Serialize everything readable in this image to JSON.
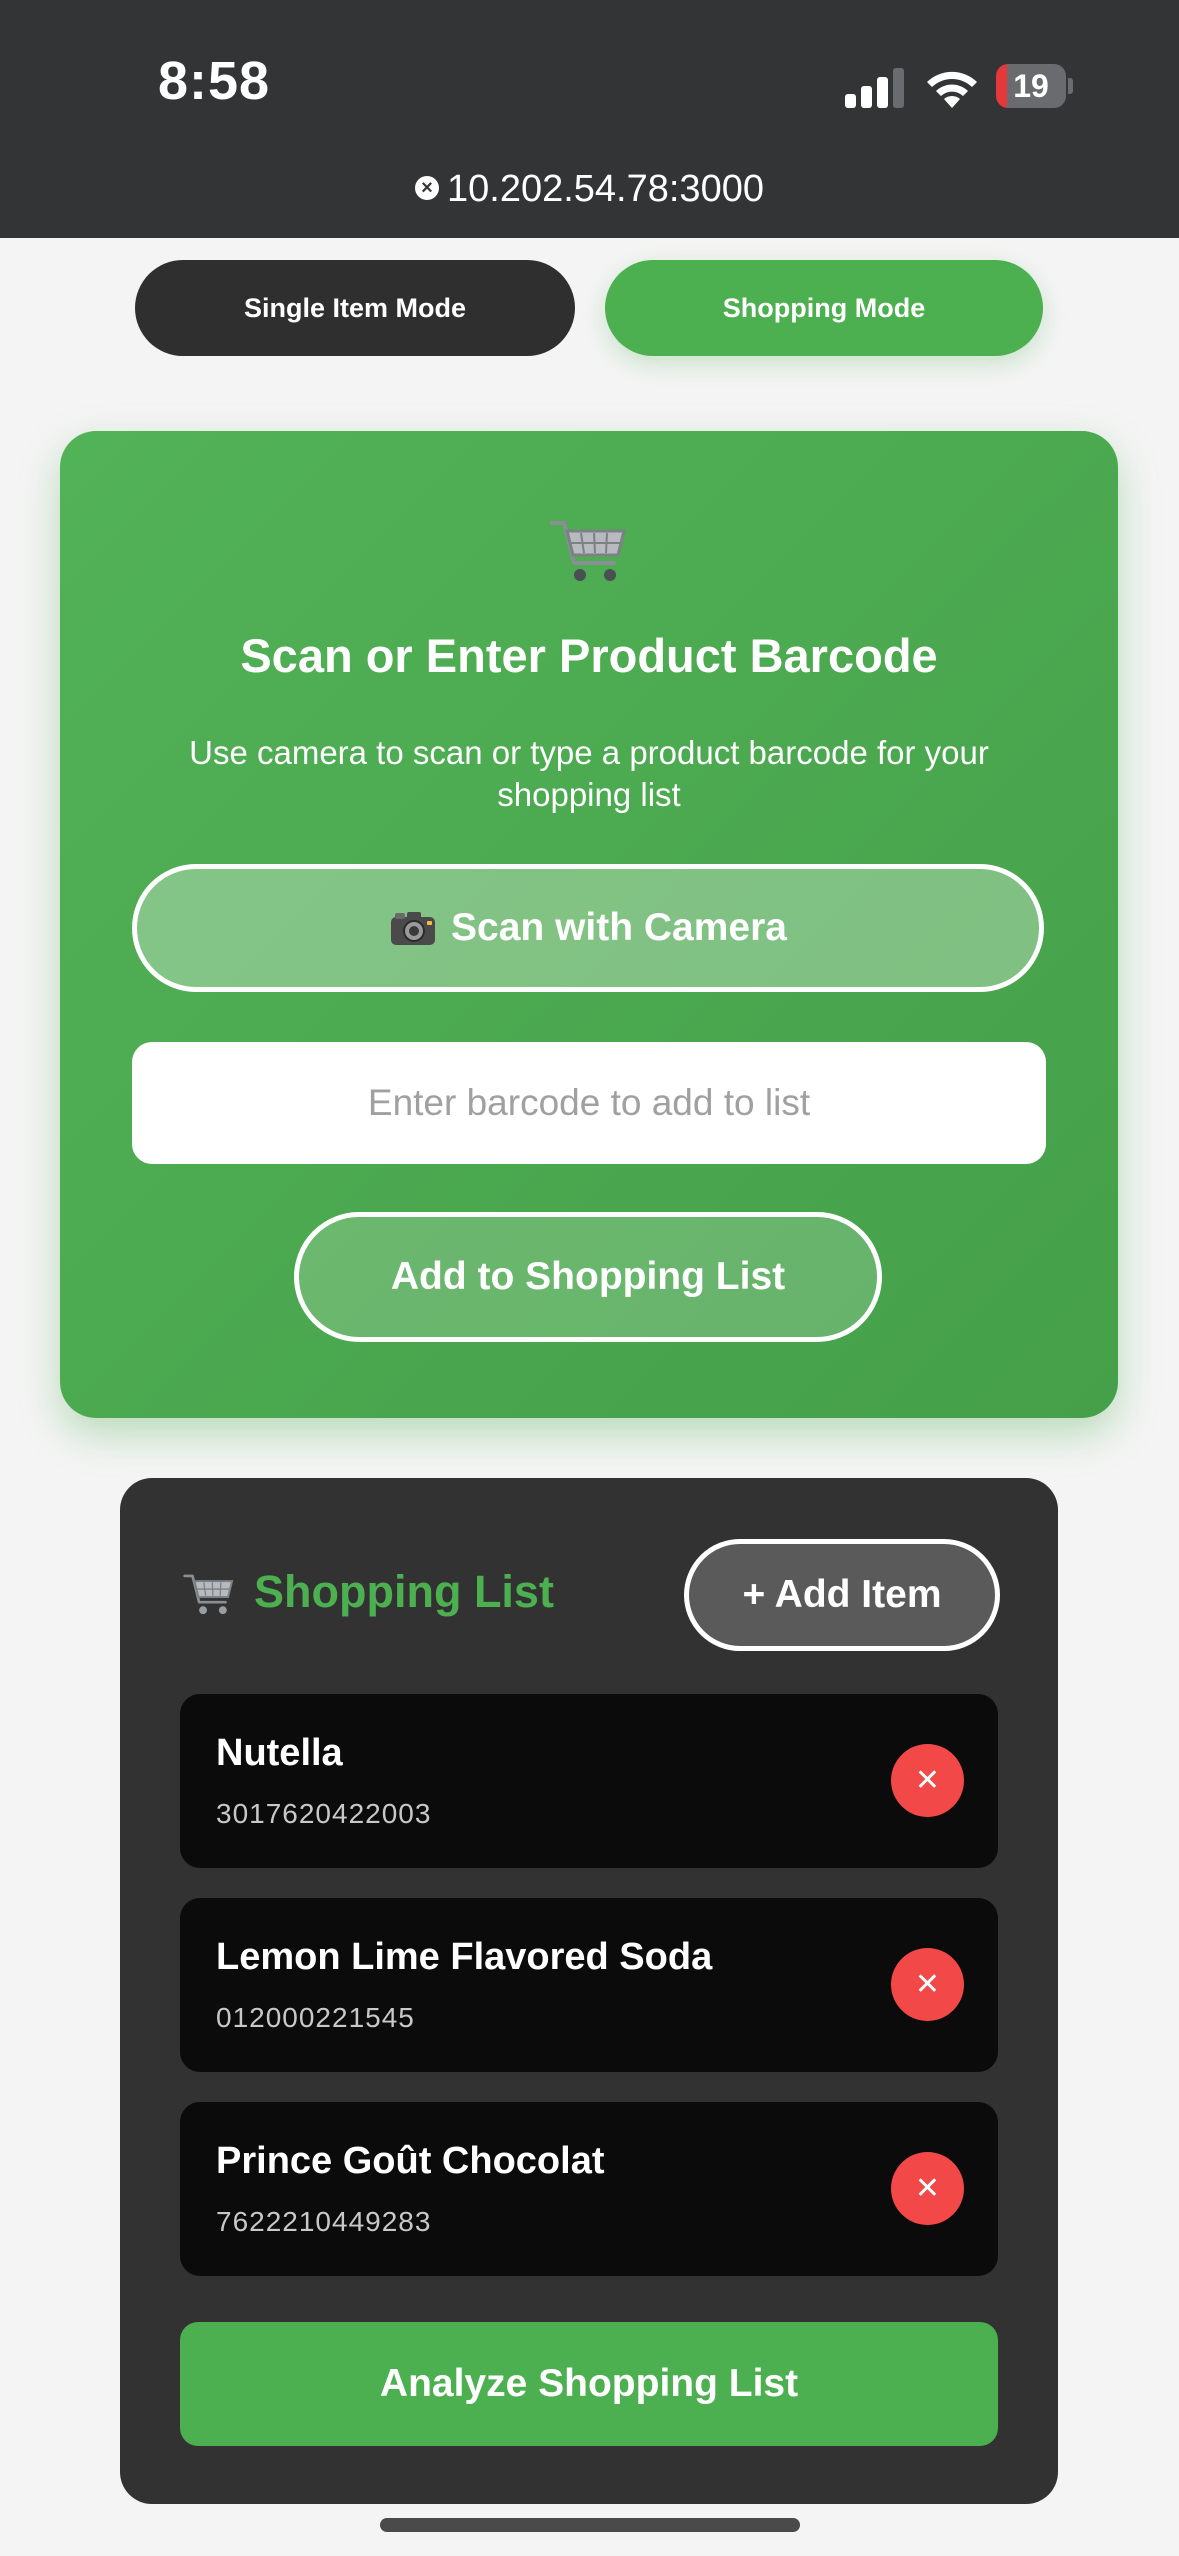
{
  "status_bar": {
    "time": "8:58",
    "battery_level": "19",
    "url": "10.202.54.78:3000",
    "url_close_glyph": "×"
  },
  "modes": {
    "single_label": "Single Item Mode",
    "shopping_label": "Shopping Mode",
    "active": "shopping"
  },
  "scanner": {
    "title": "Scan or Enter Product Barcode",
    "subtitle": "Use camera to scan or type a product barcode for your shopping list",
    "scan_button_label": "Scan with Camera",
    "barcode_placeholder": "Enter barcode to add to list",
    "add_button_label": "Add to Shopping List"
  },
  "shopping_list": {
    "title": "Shopping List",
    "add_item_label": "+ Add Item",
    "remove_glyph": "✕",
    "items": [
      {
        "name": "Nutella",
        "barcode": "3017620422003"
      },
      {
        "name": "Lemon Lime Flavored Soda",
        "barcode": "012000221545"
      },
      {
        "name": "Prince Goût Chocolat",
        "barcode": "7622210449283"
      }
    ],
    "analyze_label": "Analyze Shopping List"
  },
  "colors": {
    "accent_green": "#4caf50",
    "remove_red": "#f24848",
    "dark_panel": "#323232"
  },
  "icons": [
    "cart-icon",
    "camera-icon",
    "close-icon",
    "signal-icon",
    "wifi-icon",
    "battery-icon"
  ]
}
